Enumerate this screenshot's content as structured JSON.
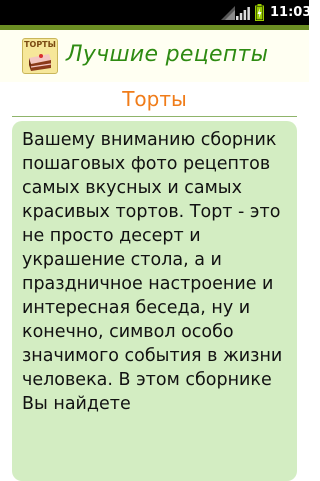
{
  "status_bar": {
    "time": "11:03",
    "wifi_icon": "wifi-icon",
    "signal_icon": "cell-signal-icon",
    "battery_icon": "battery-charging-icon"
  },
  "header": {
    "logo_icon": "cake-logo-icon",
    "logo_caption": "ТОРТЫ",
    "title": "Лучшие рецепты"
  },
  "page": {
    "title": "Торты"
  },
  "content": {
    "text": "Вашему вниманию сборник пошаговых фото рецептов самых вкусных и самых красивых тортов. Торт - это не просто десерт и украшение стола, а и праздничное настроение и интересная беседа, ну и конечно, символ особо значимого события в жизни человека. В этом сборнике Вы найдете"
  },
  "colors": {
    "status_bar": "#000000",
    "accent_line": "#6b8e23",
    "header_background": "#fffff2",
    "app_title": "#2e8b12",
    "page_title": "#f07c19",
    "card_background": "#d3edc2",
    "text": "#111111"
  }
}
